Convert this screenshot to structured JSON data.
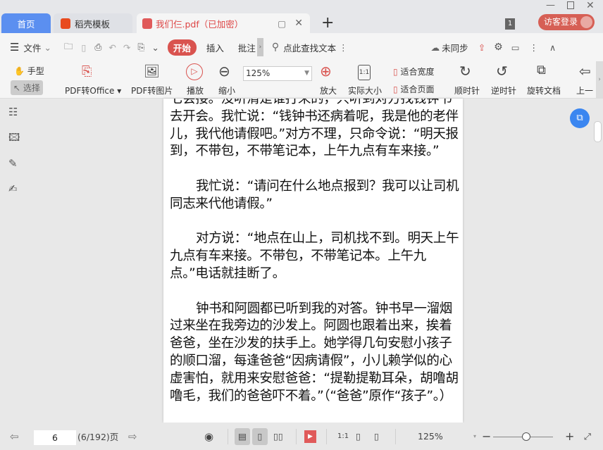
{
  "tabs": [
    {
      "label": "首页"
    },
    {
      "label": "稻壳模板"
    },
    {
      "label": "我们仨.pdf（已加密）"
    }
  ],
  "window": {
    "badge": "1",
    "login": "访客登录"
  },
  "toolbar": {
    "menu": "文件",
    "start": "开始",
    "insert": "插入",
    "annotate": "批注",
    "search": "点此查找文本",
    "sync": "未同步"
  },
  "ribbon": {
    "hand": "手型",
    "select": "选择",
    "pdf_office": "PDF转Office",
    "pdf_image": "PDF转图片",
    "play": "播放",
    "zoom_out": "缩小",
    "zoom_value": "125%",
    "zoom_in": "放大",
    "actual": "实际大小",
    "fit_width": "适合宽度",
    "fit_page": "适合页面",
    "cw": "顺时针",
    "ccw": "逆时针",
    "rotate": "旋转文档",
    "prev": "上一"
  },
  "document": {
    "paragraphs": [
      "七会接。没听清是谁打来的，只听到对方找钱钟书去开会。我忙说：“钱钟书还病着呢，我是他的老伴儿，我代他请假吧。”对方不理，只命令说：“明天报到，不带包，不带笔记本，上午九点有车来接。”",
      "我忙说：“请问在什么地点报到？我可以让司机同志来代他请假。”",
      "对方说：“地点在山上，司机找不到。明天上午九点有车来接。不带包，不带笔记本。上午九点。”电话就挂断了。",
      "钟书和阿圆都已听到我的对答。钟书早一溜烟过来坐在我旁边的沙发上。阿圆也跟着出来，挨着爸爸，坐在沙发的扶手上。她学得几句安慰小孩子的顺口溜，每逢爸爸“因病请假”，小儿赖学似的心虚害怕，就用来安慰爸爸：“提勒提勒耳朵，胡噜胡噜毛，我们的爸爸吓不着。”（“爸爸”原作“孩子”。）"
    ]
  },
  "status": {
    "page": "6",
    "page_info": "(6/192)页",
    "zoom": "125%",
    "zoom_fraction": 0.55
  },
  "colors": {
    "accent": "#d9534f",
    "tab_blue": "#5b8ff0"
  }
}
